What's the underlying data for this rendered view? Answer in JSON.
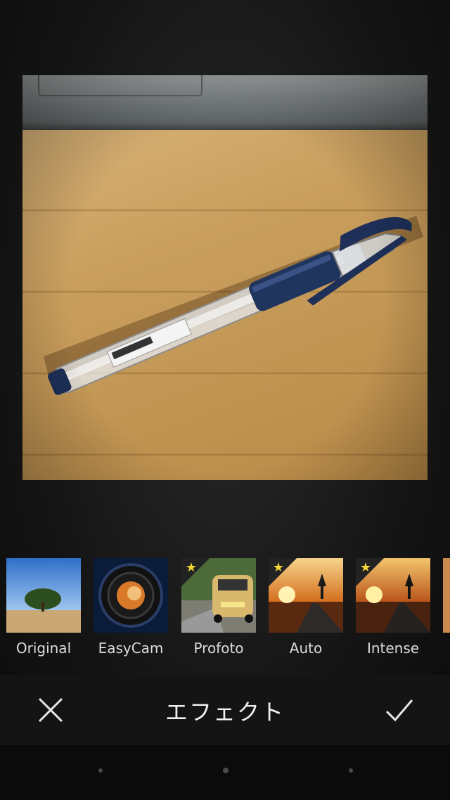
{
  "header": {
    "title": "エフェクト"
  },
  "actions": {
    "cancel_icon": "close-icon",
    "confirm_icon": "check-icon"
  },
  "filters": [
    {
      "label": "Original",
      "premium": false
    },
    {
      "label": "EasyCam",
      "premium": false
    },
    {
      "label": "Profoto",
      "premium": true
    },
    {
      "label": "Auto",
      "premium": true
    },
    {
      "label": "Intense",
      "premium": true
    }
  ],
  "colors": {
    "accent_star": "#f2d635",
    "background": "#151515"
  }
}
